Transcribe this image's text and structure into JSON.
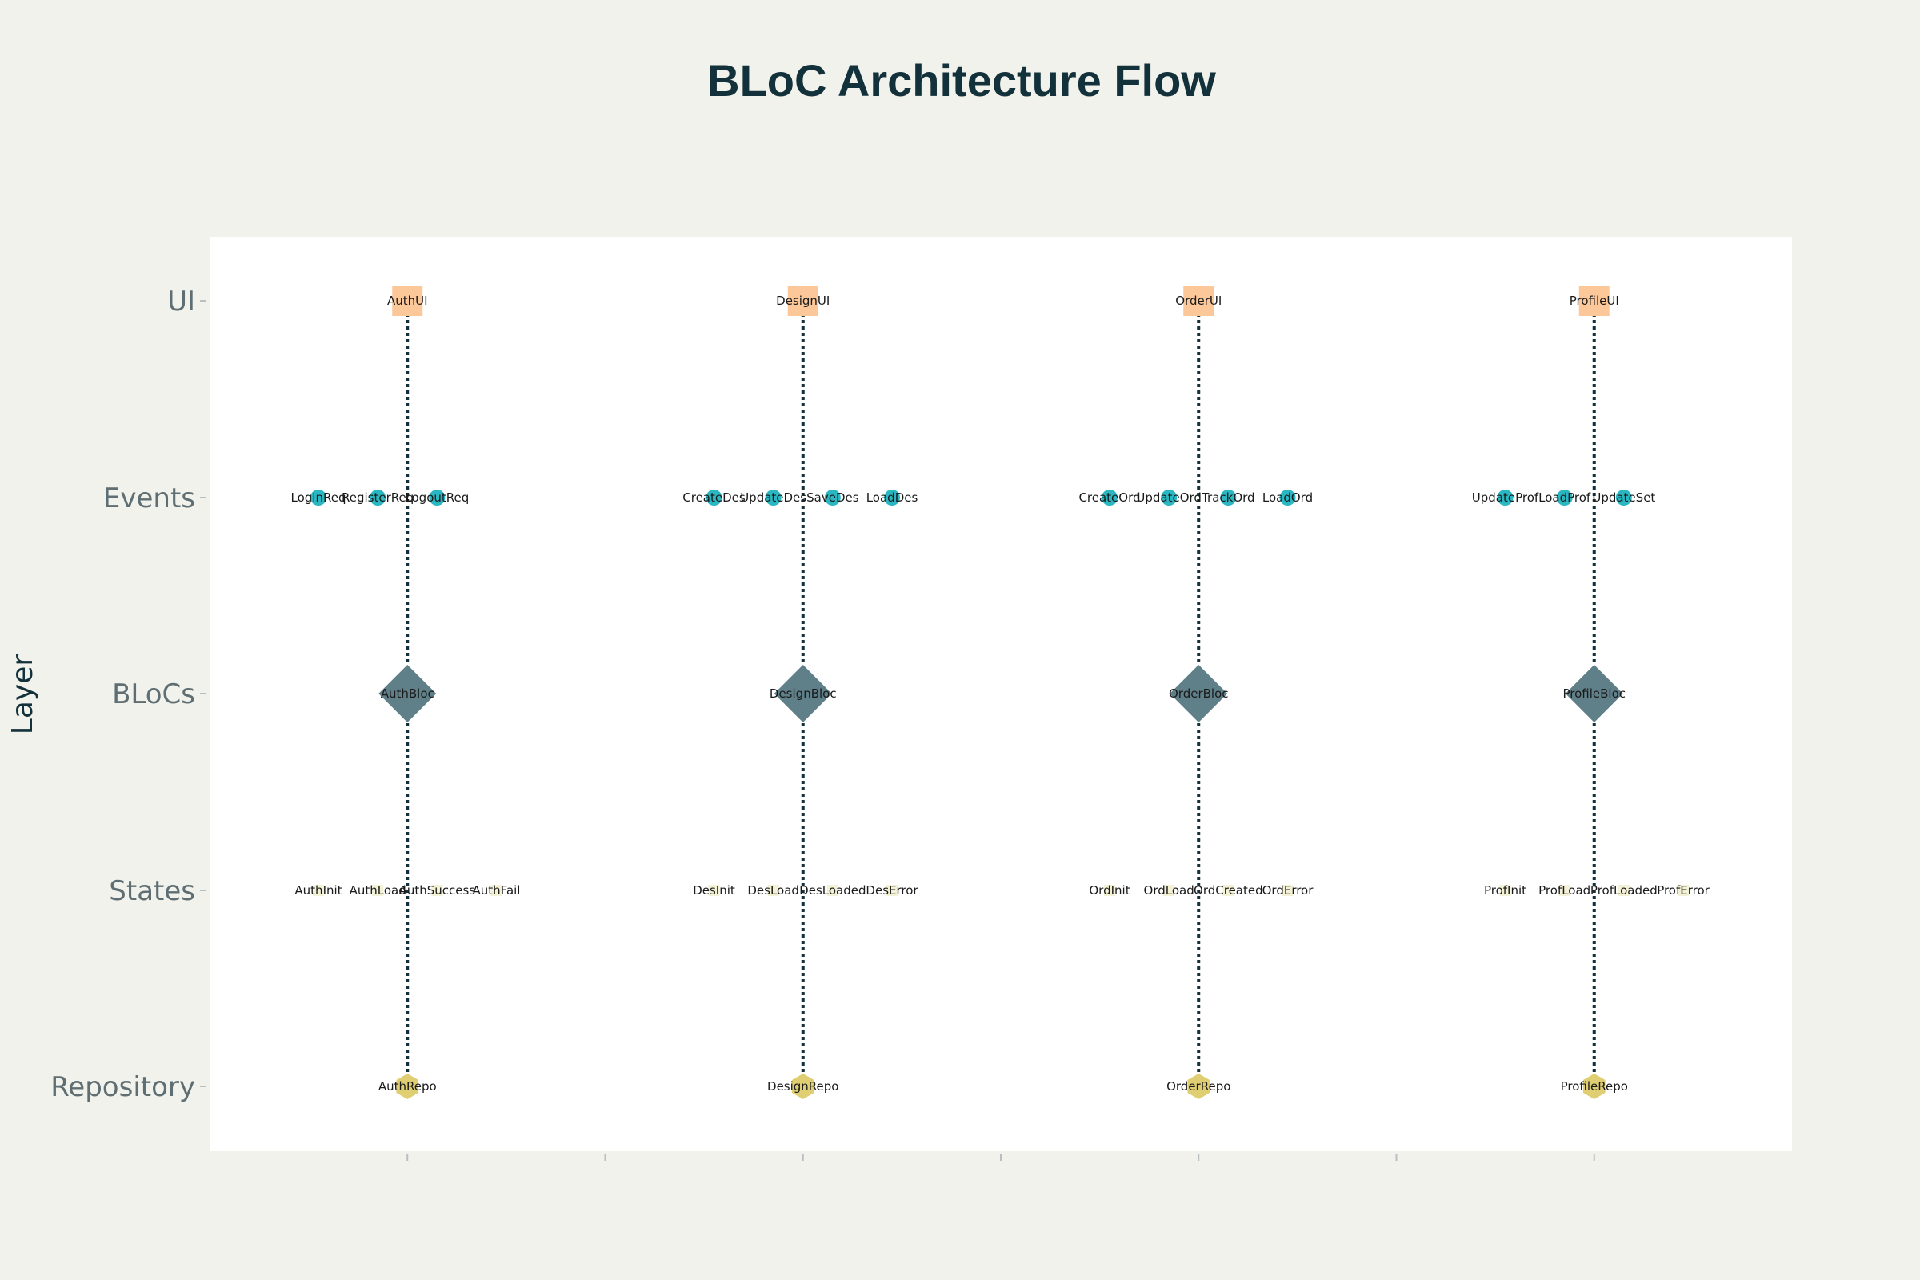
{
  "chart_data": {
    "type": "scatter",
    "title": "BLoC Architecture Flow",
    "ylabel": "Layer",
    "xlabel": "",
    "y_categories": [
      "UI",
      "Events",
      "BLoCs",
      "States",
      "Repository"
    ],
    "xlim": [
      -0.5,
      3.5
    ],
    "x_ticks": [
      0,
      0.5,
      1,
      1.5,
      2,
      2.5,
      3
    ],
    "x_tick_labels_visible": false,
    "grid": false,
    "colors": {
      "page_bg": "#f2f2ed",
      "plot_bg": "#ffffff",
      "title": "#12313a",
      "axis_label": "#12313a",
      "tick_label": "#5e6e72",
      "tick": "#b9bfc0",
      "flow_line": "#12313a",
      "node_text": "#1a1a1a"
    },
    "layer_styles": {
      "UI": {
        "marker": "square",
        "color": "#fcc89a"
      },
      "Events": {
        "marker": "circle",
        "color": "#2ab7c2"
      },
      "BLoCs": {
        "marker": "diamond",
        "color": "#5f7f89"
      },
      "States": {
        "marker": "square",
        "color": "#f3f1d6"
      },
      "Repository": {
        "marker": "hexagon",
        "color": "#e0cf72"
      }
    },
    "flows": [
      {
        "feature": "Auth",
        "x": 0,
        "from": "UI",
        "to": "Repository"
      },
      {
        "feature": "Design",
        "x": 1,
        "from": "UI",
        "to": "Repository"
      },
      {
        "feature": "Order",
        "x": 2,
        "from": "UI",
        "to": "Repository"
      },
      {
        "feature": "Profile",
        "x": 3,
        "from": "UI",
        "to": "Repository"
      }
    ],
    "nodes": [
      {
        "label": "AuthUI",
        "layer": "UI",
        "x": 0
      },
      {
        "label": "DesignUI",
        "layer": "UI",
        "x": 1
      },
      {
        "label": "OrderUI",
        "layer": "UI",
        "x": 2
      },
      {
        "label": "ProfileUI",
        "layer": "UI",
        "x": 3
      },
      {
        "label": "LoginReq",
        "layer": "Events",
        "x": -0.225
      },
      {
        "label": "RegisterReq",
        "layer": "Events",
        "x": -0.075
      },
      {
        "label": "LogoutReq",
        "layer": "Events",
        "x": 0.075
      },
      {
        "label": "CreateDes",
        "layer": "Events",
        "x": 0.775
      },
      {
        "label": "UpdateDes",
        "layer": "Events",
        "x": 0.925
      },
      {
        "label": "SaveDes",
        "layer": "Events",
        "x": 1.075
      },
      {
        "label": "LoadDes",
        "layer": "Events",
        "x": 1.225
      },
      {
        "label": "CreateOrd",
        "layer": "Events",
        "x": 1.775
      },
      {
        "label": "UpdateOrd",
        "layer": "Events",
        "x": 1.925
      },
      {
        "label": "TrackOrd",
        "layer": "Events",
        "x": 2.075
      },
      {
        "label": "LoadOrd",
        "layer": "Events",
        "x": 2.225
      },
      {
        "label": "UpdateProf",
        "layer": "Events",
        "x": 2.775
      },
      {
        "label": "LoadProf",
        "layer": "Events",
        "x": 2.925
      },
      {
        "label": "UpdateSet",
        "layer": "Events",
        "x": 3.075
      },
      {
        "label": "AuthBloc",
        "layer": "BLoCs",
        "x": 0
      },
      {
        "label": "DesignBloc",
        "layer": "BLoCs",
        "x": 1
      },
      {
        "label": "OrderBloc",
        "layer": "BLoCs",
        "x": 2
      },
      {
        "label": "ProfileBloc",
        "layer": "BLoCs",
        "x": 3
      },
      {
        "label": "AuthInit",
        "layer": "States",
        "x": -0.225
      },
      {
        "label": "AuthLoad",
        "layer": "States",
        "x": -0.075
      },
      {
        "label": "AuthSuccess",
        "layer": "States",
        "x": 0.075
      },
      {
        "label": "AuthFail",
        "layer": "States",
        "x": 0.225
      },
      {
        "label": "DesInit",
        "layer": "States",
        "x": 0.775
      },
      {
        "label": "DesLoad",
        "layer": "States",
        "x": 0.925
      },
      {
        "label": "DesLoaded",
        "layer": "States",
        "x": 1.075
      },
      {
        "label": "DesError",
        "layer": "States",
        "x": 1.225
      },
      {
        "label": "OrdInit",
        "layer": "States",
        "x": 1.775
      },
      {
        "label": "OrdLoad",
        "layer": "States",
        "x": 1.925
      },
      {
        "label": "OrdCreated",
        "layer": "States",
        "x": 2.075
      },
      {
        "label": "OrdError",
        "layer": "States",
        "x": 2.225
      },
      {
        "label": "ProfInit",
        "layer": "States",
        "x": 2.775
      },
      {
        "label": "ProfLoad",
        "layer": "States",
        "x": 2.925
      },
      {
        "label": "ProfLoaded",
        "layer": "States",
        "x": 3.075
      },
      {
        "label": "ProfError",
        "layer": "States",
        "x": 3.225
      },
      {
        "label": "AuthRepo",
        "layer": "Repository",
        "x": 0
      },
      {
        "label": "DesignRepo",
        "layer": "Repository",
        "x": 1
      },
      {
        "label": "OrderRepo",
        "layer": "Repository",
        "x": 2
      },
      {
        "label": "ProfileRepo",
        "layer": "Repository",
        "x": 3
      }
    ]
  }
}
